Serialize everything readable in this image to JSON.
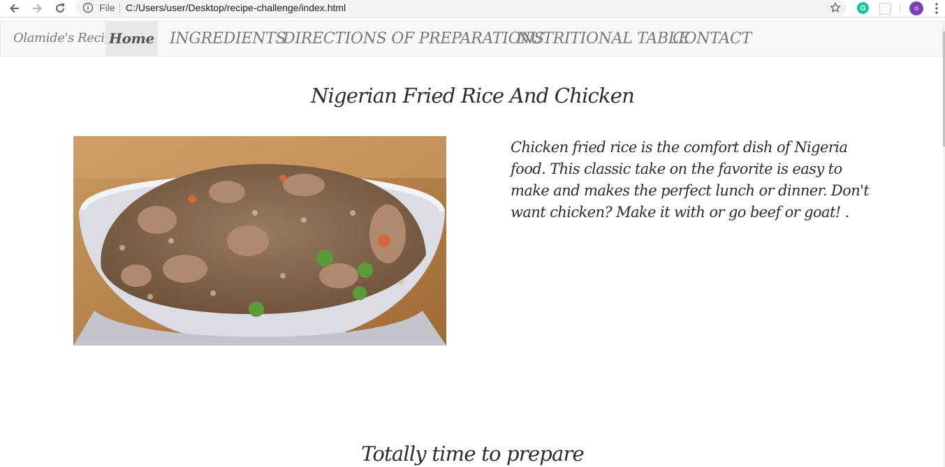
{
  "browser": {
    "file_label": "File",
    "url": "C:/Users/user/Desktop/recipe-challenge/index.html",
    "profile_initial": "o",
    "extension_g": "G"
  },
  "navbar": {
    "brand": "Olamide's Recipe",
    "items": [
      {
        "label": "Home",
        "active": true
      },
      {
        "label": "INGREDIENTS"
      },
      {
        "label": "DIRECTIONS OF PREPARATIONS"
      },
      {
        "label": "NUTRITIONAL TABLE"
      },
      {
        "label": "CONTACT"
      }
    ]
  },
  "content": {
    "title": "Nigerian Fried Rice And Chicken",
    "description": "Chicken fried rice is the comfort dish of Nigeria food. This classic take on the favorite is easy to make and makes the perfect lunch or dinner. Don't want chicken? Make it with or go beef or goat! .",
    "section_title": "Totally time to prepare"
  },
  "colors": {
    "navbar_bg": "#f8f8f8",
    "active_bg": "#e7e7e7",
    "nav_text": "#777777",
    "body_text": "#2b2b2b"
  }
}
